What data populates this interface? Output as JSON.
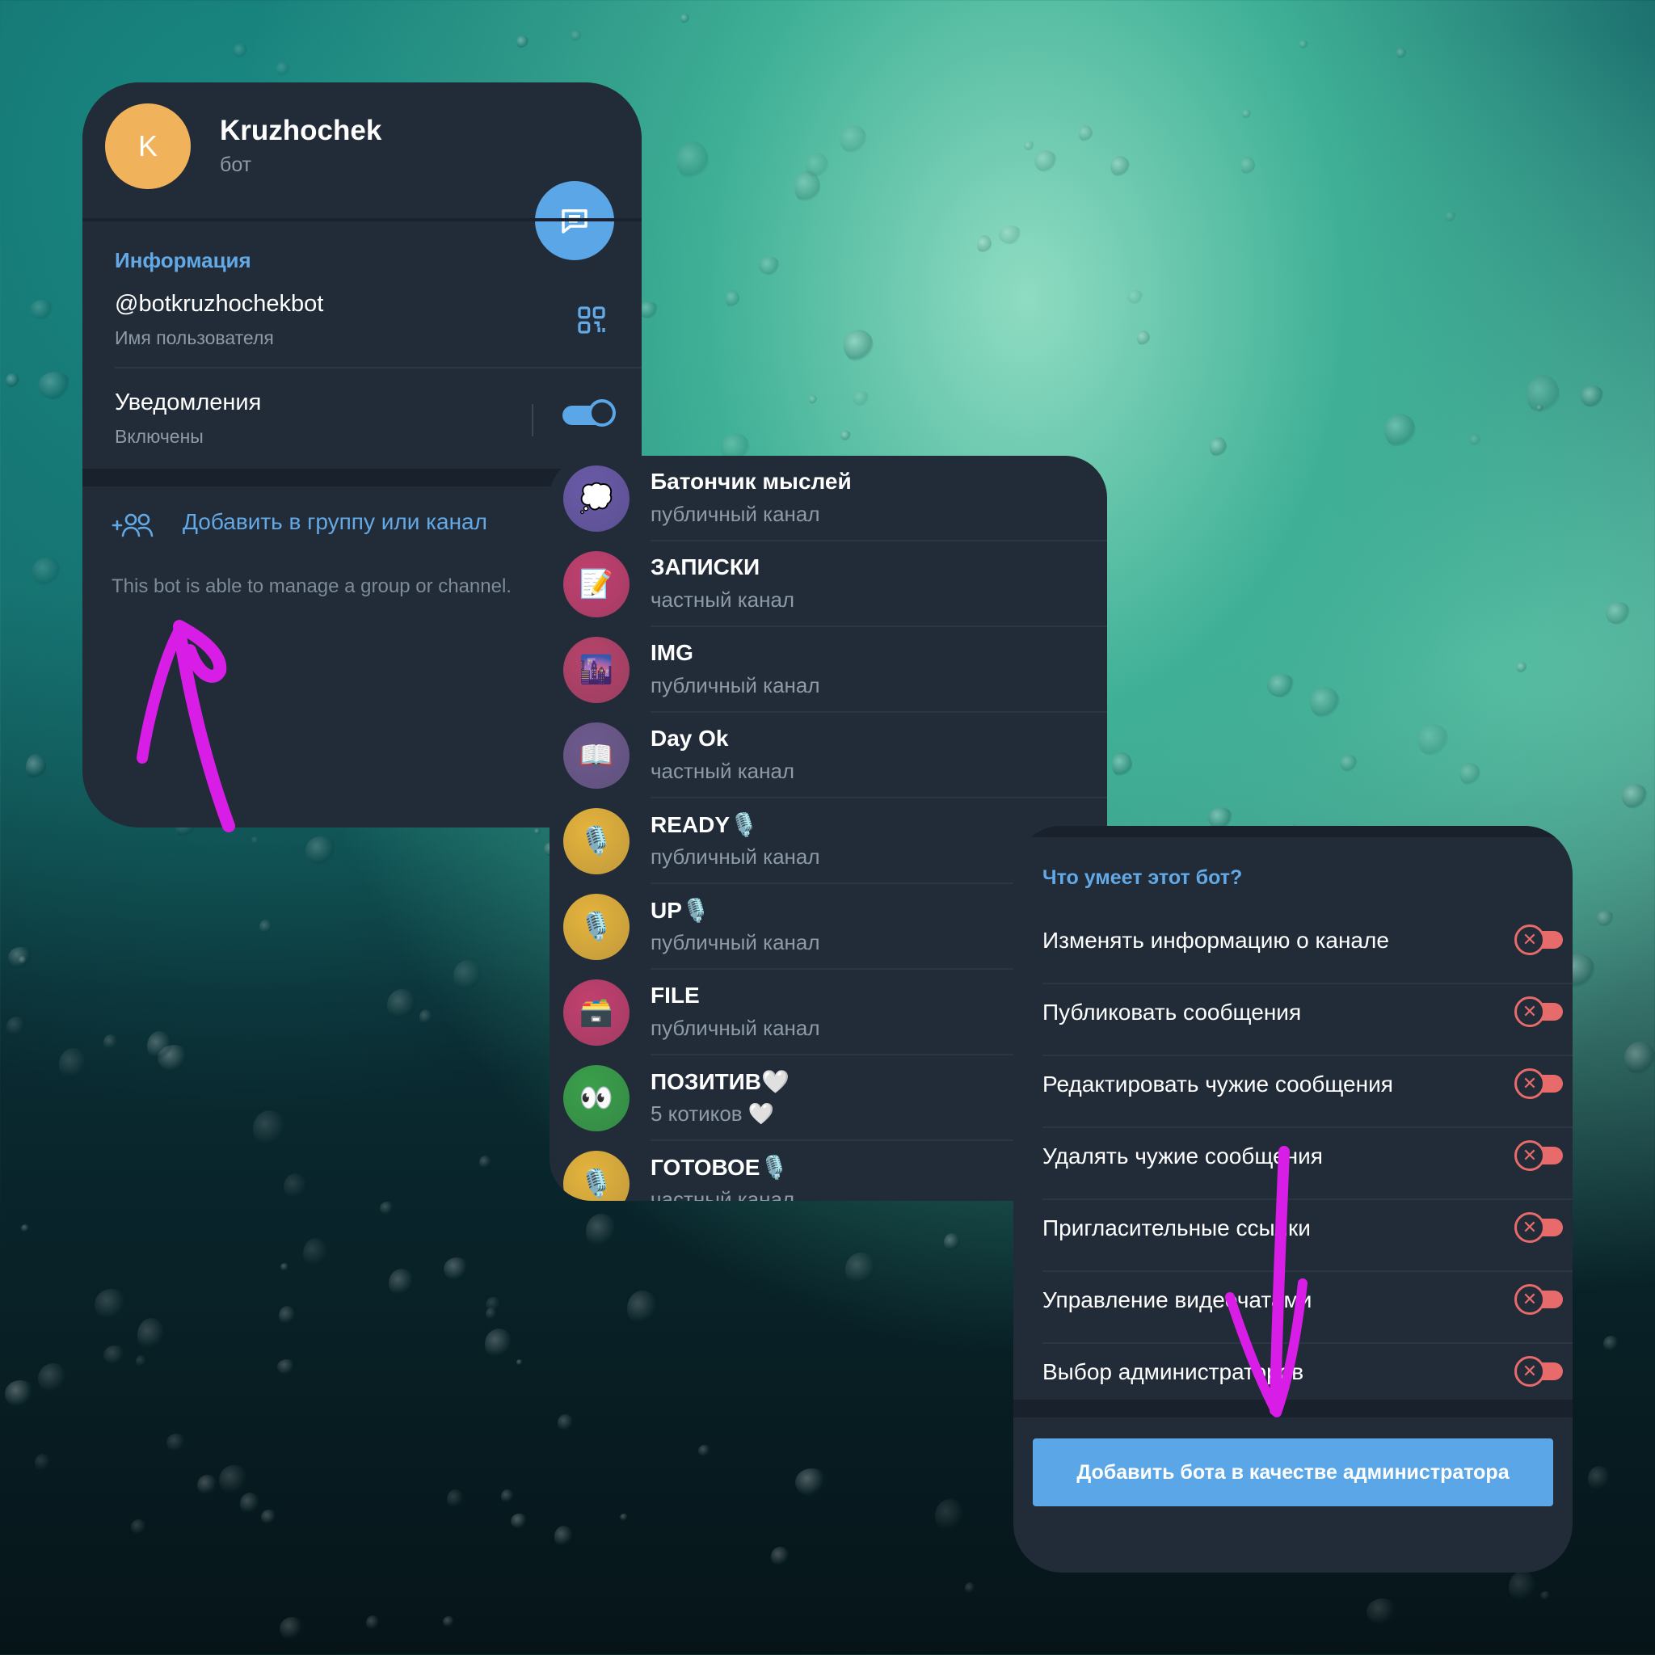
{
  "bot": {
    "avatar_letter": "K",
    "name": "Kruzhochek",
    "type": "бот",
    "info_title": "Информация",
    "username": "@botkruzhochekbot",
    "username_label": "Имя пользователя",
    "notifications_label": "Уведомления",
    "notifications_state": "Включены",
    "add_label": "Добавить в группу или канал",
    "description": "This bot is able to manage a group or channel."
  },
  "channels": [
    {
      "title": "Батончик мыслей",
      "subtitle": "публичный канал",
      "color": "#6a5aa8",
      "icon": "💭"
    },
    {
      "title": "ЗАПИСКИ",
      "subtitle": "частный канал",
      "color": "#c2406e",
      "icon": "📝"
    },
    {
      "title": "IMG",
      "subtitle": "публичный канал",
      "color": "#b8436a",
      "icon": "🌆"
    },
    {
      "title": "Day Ok",
      "subtitle": "частный канал",
      "color": "#6e5a8e",
      "icon": "📖"
    },
    {
      "title": "READY🎙️",
      "subtitle": "публичный канал",
      "color": "#e6b43c",
      "icon": "🎙️"
    },
    {
      "title": "UP🎙️",
      "subtitle": "публичный канал",
      "color": "#e6b43c",
      "icon": "🎙️"
    },
    {
      "title": "FILE",
      "subtitle": "публичный канал",
      "color": "#c2406e",
      "icon": "🗃️"
    },
    {
      "title": "ПОЗИТИВ🤍",
      "subtitle": "5 котиков 🤍",
      "color": "#3aa04a",
      "icon": "👀"
    },
    {
      "title": "ГОТОВОЕ🎙️",
      "subtitle": "частный канал",
      "color": "#e6b43c",
      "icon": "🎙️"
    }
  ],
  "permissions": {
    "title": "Что умеет этот бот?",
    "items": [
      "Изменять информацию о канале",
      "Публиковать сообщения",
      "Редактировать чужие сообщения",
      "Удалять чужие сообщения",
      "Пригласительные ссылки",
      "Управление видеочатами",
      "Выбор администраторов"
    ],
    "toggle_color": "#e86b6b",
    "button": "Добавить бота в качестве администратора"
  },
  "colors": {
    "accent": "#5aa6e6",
    "panel": "#222b38",
    "annotation": "#d81ee6"
  }
}
